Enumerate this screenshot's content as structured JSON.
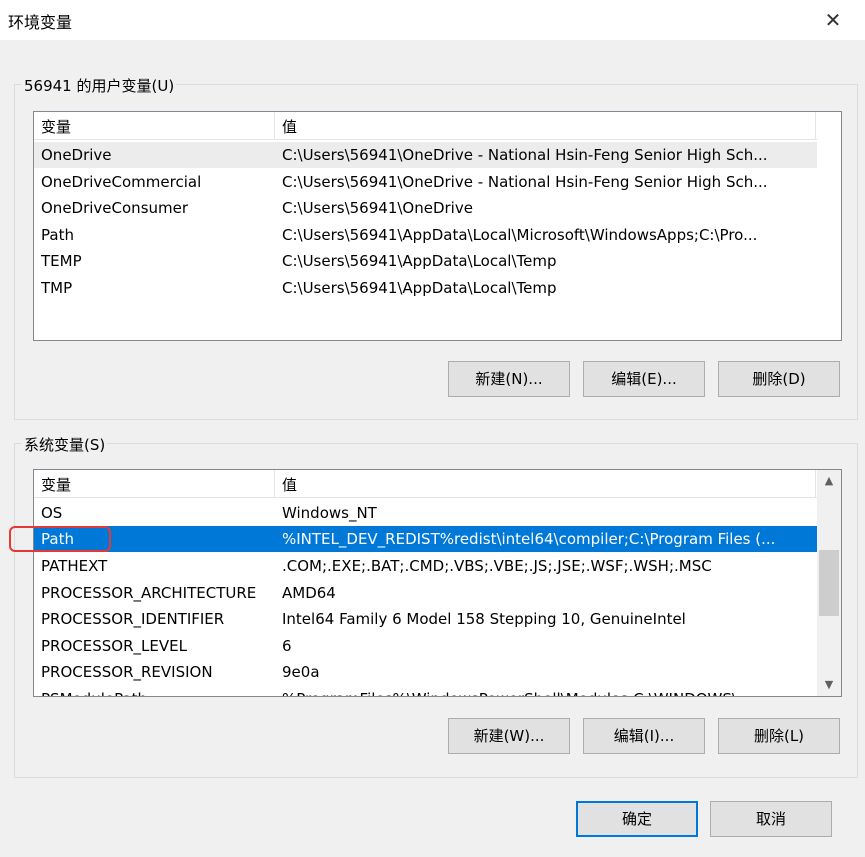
{
  "window": {
    "title": "环境变量",
    "close_glyph": "✕"
  },
  "user_vars": {
    "label": "56941 的用户变量(U)",
    "columns": [
      "变量",
      "值"
    ],
    "rows": [
      {
        "name": "OneDrive",
        "value": "C:\\Users\\56941\\OneDrive - National Hsin-Feng Senior High Sch..."
      },
      {
        "name": "OneDriveCommercial",
        "value": "C:\\Users\\56941\\OneDrive - National Hsin-Feng Senior High Sch..."
      },
      {
        "name": "OneDriveConsumer",
        "value": "C:\\Users\\56941\\OneDrive"
      },
      {
        "name": "Path",
        "value": "C:\\Users\\56941\\AppData\\Local\\Microsoft\\WindowsApps;C:\\Pro..."
      },
      {
        "name": "TEMP",
        "value": "C:\\Users\\56941\\AppData\\Local\\Temp"
      },
      {
        "name": "TMP",
        "value": "C:\\Users\\56941\\AppData\\Local\\Temp"
      }
    ],
    "buttons": {
      "new": "新建(N)...",
      "edit": "编辑(E)...",
      "delete": "删除(D)"
    }
  },
  "system_vars": {
    "label": "系统变量(S)",
    "columns": [
      "变量",
      "值"
    ],
    "rows": [
      {
        "name": "OS",
        "value": "Windows_NT"
      },
      {
        "name": "Path",
        "value": "%INTEL_DEV_REDIST%redist\\intel64\\compiler;C:\\Program Files (..."
      },
      {
        "name": "PATHEXT",
        "value": ".COM;.EXE;.BAT;.CMD;.VBS;.VBE;.JS;.JSE;.WSF;.WSH;.MSC"
      },
      {
        "name": "PROCESSOR_ARCHITECTURE",
        "value": "AMD64"
      },
      {
        "name": "PROCESSOR_IDENTIFIER",
        "value": "Intel64 Family 6 Model 158 Stepping 10, GenuineIntel"
      },
      {
        "name": "PROCESSOR_LEVEL",
        "value": "6"
      },
      {
        "name": "PROCESSOR_REVISION",
        "value": "9e0a"
      },
      {
        "name": "PSModulePath",
        "value": "%ProgramFiles%\\WindowsPowerShell\\Modules;C:\\WINDOWS\\..."
      }
    ],
    "selected_index": 1,
    "buttons": {
      "new": "新建(W)...",
      "edit": "编辑(I)...",
      "delete": "删除(L)"
    }
  },
  "footer": {
    "ok": "确定",
    "cancel": "取消"
  },
  "colors": {
    "selection": "#0078d7",
    "annotation": "#e53935"
  }
}
